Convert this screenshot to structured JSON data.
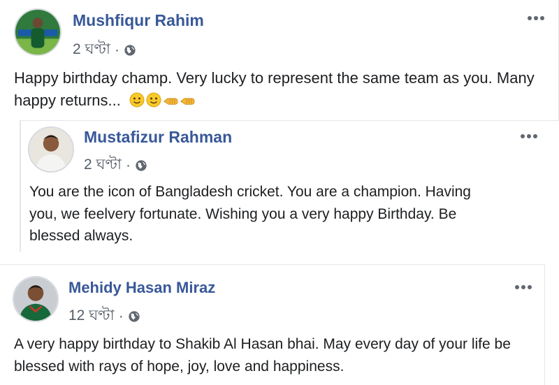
{
  "posts": [
    {
      "author": "Mushfiqur Rahim",
      "time": "2 ঘণ্টা",
      "text": "Happy birthday champ. Very lucky to represent the same team as you. Many happy returns...",
      "emojis": [
        "slightly-smiling-face",
        "slightly-smiling-face",
        "oncoming-fist",
        "oncoming-fist"
      ]
    },
    {
      "author": "Mustafizur Rahman",
      "time": "2 ঘণ্টা",
      "text": "You are the icon of Bangladesh cricket. You are a champion. Having you, we feelvery fortunate. Wishing you a very happy Birthday. Be blessed always."
    },
    {
      "author": "Mehidy Hasan Miraz",
      "time": "12 ঘণ্টা",
      "text": "A very happy birthday to Shakib Al Hasan bhai. May every day of your life be blessed with rays of hope, joy, love and happiness."
    }
  ],
  "separator": "·",
  "icons": {
    "privacy": "globe-icon",
    "menu": "more-options-icon"
  },
  "colors": {
    "name": "#385898",
    "meta": "#555c66",
    "text": "#1c1e21"
  }
}
